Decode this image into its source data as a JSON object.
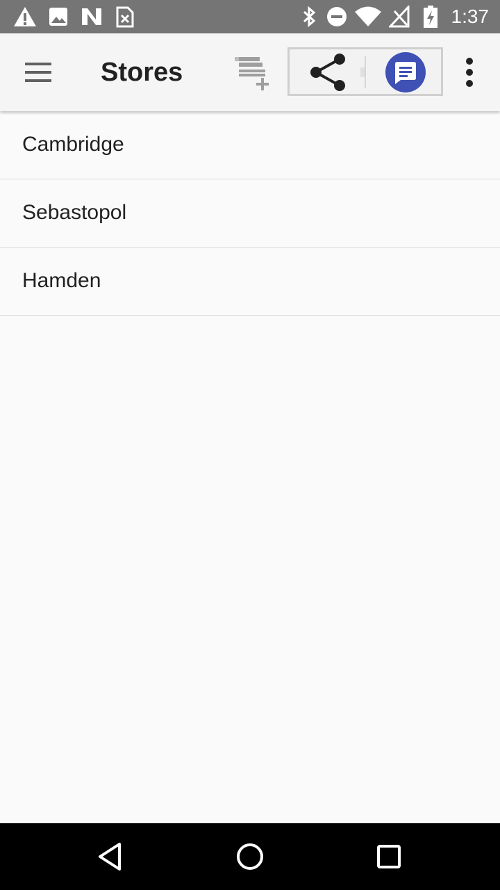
{
  "status_bar": {
    "time": "1:37",
    "left_icons": [
      "alert-icon",
      "image-icon",
      "n-app-icon",
      "sim-card-icon"
    ],
    "right_icons": [
      "bluetooth-icon",
      "do-not-disturb-icon",
      "wifi-icon",
      "signal-off-icon",
      "battery-charging-icon"
    ]
  },
  "app_bar": {
    "title": "Stores",
    "icons": [
      "menu-icon",
      "add-list-icon",
      "share-icon",
      "messages-icon",
      "overflow-menu-icon"
    ],
    "messages_accent": "#3f51b5"
  },
  "stores": {
    "items": [
      {
        "label": "Cambridge"
      },
      {
        "label": "Sebastopol"
      },
      {
        "label": "Hamden"
      }
    ]
  },
  "nav_bar": {
    "icons": [
      "back-icon",
      "home-icon",
      "recents-icon"
    ]
  }
}
